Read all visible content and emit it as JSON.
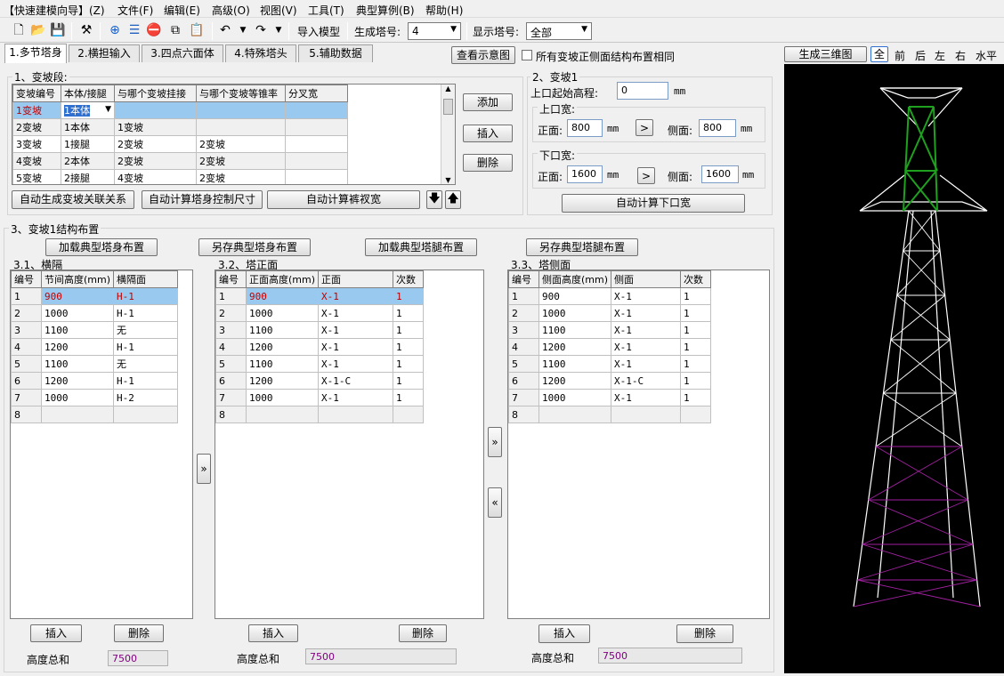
{
  "menu": [
    "【快速建模向导】(Z)",
    "文件(F)",
    "编辑(E)",
    "高级(O)",
    "视图(V)",
    "工具(T)",
    "典型算例(B)",
    "帮助(H)"
  ],
  "toolbar": {
    "import_label": "导入模型",
    "gen_tower_label": "生成塔号:",
    "gen_tower_value": "4",
    "show_tower_label": "显示塔号:",
    "show_tower_value": "全部"
  },
  "tabs": [
    "1.多节塔身",
    "2.横担输入",
    "3.四点六面体",
    "4.特殊塔头",
    "5.辅助数据"
  ],
  "view_schematic_label": "查看示意图",
  "same_layout_label": "所有变坡正侧面结构布置相同",
  "section1": {
    "title": "1、变坡段:",
    "headers": [
      "变坡编号",
      "本体/接腿",
      "与哪个变坡挂接",
      "与哪个变坡等锥率",
      "分叉宽"
    ],
    "rows": [
      [
        "1变坡",
        "1本体",
        "",
        "",
        ""
      ],
      [
        "2变坡",
        "1本体",
        "1变坡",
        "",
        ""
      ],
      [
        "3变坡",
        "1接腿",
        "2变坡",
        "2变坡",
        ""
      ],
      [
        "4变坡",
        "2本体",
        "2变坡",
        "2变坡",
        ""
      ],
      [
        "5变坡",
        "2接腿",
        "4变坡",
        "2变坡",
        ""
      ]
    ],
    "add_label": "添加",
    "insert_label": "插入",
    "delete_label": "删除",
    "auto_gen_label": "自动生成变坡关联关系",
    "auto_calc_size_label": "自动计算塔身控制尺寸",
    "auto_calc_view_label": "自动计算裤衩宽"
  },
  "section2": {
    "title": "2、变坡1",
    "start_elev_label": "上口起始高程:",
    "start_elev_value": "0",
    "unit": "mm",
    "top_width_label": "上口宽:",
    "front_label": "正面:",
    "side_label": "侧面:",
    "top_front": "800",
    "top_side": "800",
    "bottom_width_label": "下口宽:",
    "bottom_front": "1600",
    "bottom_side": "1600",
    "calc_bottom_label": "自动计算下口宽"
  },
  "section3": {
    "title": "3、变坡1结构布置",
    "load_body_label": "加载典型塔身布置",
    "save_body_label": "另存典型塔身布置",
    "load_leg_label": "加载典型塔腿布置",
    "save_leg_label": "另存典型塔腿布置",
    "sub1": {
      "title": "3.1、横隔",
      "headers": [
        "编号",
        "节间高度(mm)",
        "横隔面"
      ],
      "rows": [
        [
          "1",
          "900",
          "H-1"
        ],
        [
          "2",
          "1000",
          "H-1"
        ],
        [
          "3",
          "1100",
          "无"
        ],
        [
          "4",
          "1200",
          "H-1"
        ],
        [
          "5",
          "1100",
          "无"
        ],
        [
          "6",
          "1200",
          "H-1"
        ],
        [
          "7",
          "1000",
          "H-2"
        ],
        [
          "8",
          "",
          ""
        ]
      ]
    },
    "sub2": {
      "title": "3.2、塔正面",
      "headers": [
        "编号",
        "正面高度(mm)",
        "正面",
        "次数"
      ],
      "rows": [
        [
          "1",
          "900",
          "X-1",
          "1"
        ],
        [
          "2",
          "1000",
          "X-1",
          "1"
        ],
        [
          "3",
          "1100",
          "X-1",
          "1"
        ],
        [
          "4",
          "1200",
          "X-1",
          "1"
        ],
        [
          "5",
          "1100",
          "X-1",
          "1"
        ],
        [
          "6",
          "1200",
          "X-1-C",
          "1"
        ],
        [
          "7",
          "1000",
          "X-1",
          "1"
        ],
        [
          "8",
          "",
          "",
          ""
        ]
      ]
    },
    "sub3": {
      "title": "3.3、塔侧面",
      "headers": [
        "编号",
        "侧面高度(mm)",
        "侧面",
        "次数"
      ],
      "rows": [
        [
          "1",
          "900",
          "X-1",
          "1"
        ],
        [
          "2",
          "1000",
          "X-1",
          "1"
        ],
        [
          "3",
          "1100",
          "X-1",
          "1"
        ],
        [
          "4",
          "1200",
          "X-1",
          "1"
        ],
        [
          "5",
          "1100",
          "X-1",
          "1"
        ],
        [
          "6",
          "1200",
          "X-1-C",
          "1"
        ],
        [
          "7",
          "1000",
          "X-1",
          "1"
        ],
        [
          "8",
          "",
          "",
          ""
        ]
      ]
    },
    "insert_label": "插入",
    "delete_label": "删除",
    "height_sum_label": "高度总和",
    "height_sum_value": "7500",
    "copy_right": "»",
    "copy_left": "«"
  },
  "viewer": {
    "gen3d_label": "生成三维图",
    "views": [
      "全",
      "前",
      "后",
      "左",
      "右",
      "水平"
    ]
  },
  "colors": {
    "selection": "#99c9ef",
    "selected_text": "#c00000",
    "canvas": "#000000",
    "tower_white": "#ffffff",
    "tower_green": "#1fa01f",
    "tower_purple": "#a020a0"
  }
}
